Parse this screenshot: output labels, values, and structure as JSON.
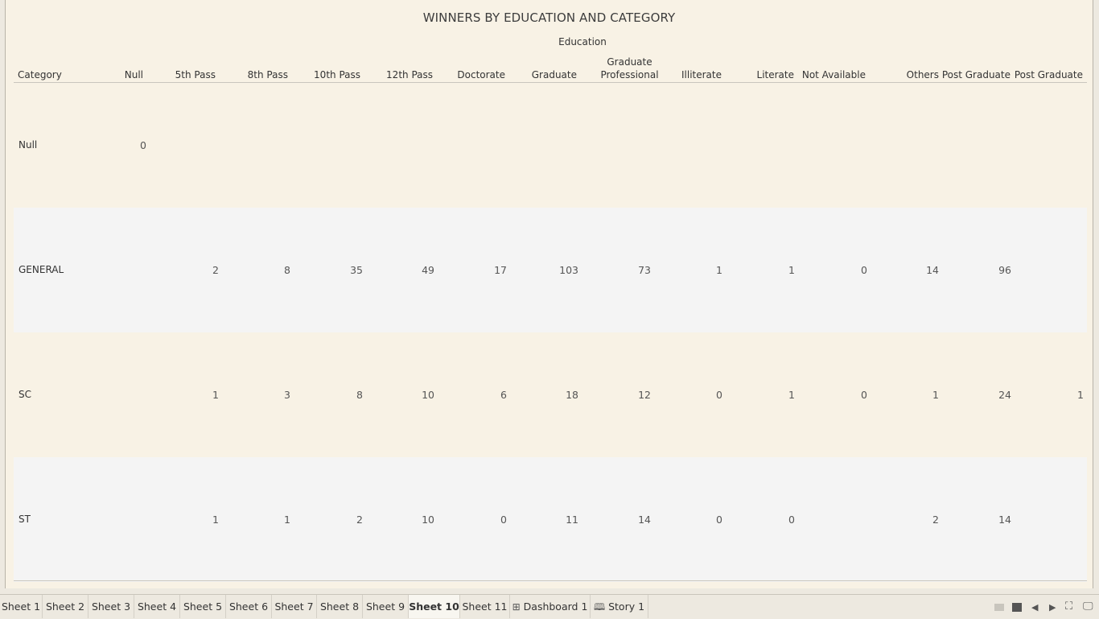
{
  "title": "WINNERS BY EDUCATION AND CATEGORY",
  "column_group_label": "Education",
  "row_header": "Category",
  "columns": [
    "Null",
    "5th Pass",
    "8th Pass",
    "10th Pass",
    "12th Pass",
    "Doctorate",
    "Graduate",
    "Graduate Professional",
    "Illiterate",
    "Literate",
    "Not Available",
    "Others",
    "Post Graduate",
    "Post Graduate"
  ],
  "column_gp_line1": "Graduate",
  "column_gp_line2": "Professional",
  "rows": [
    {
      "label": "Null",
      "values": [
        "0",
        "",
        "",
        "",
        "",
        "",
        "",
        "",
        "",
        "",
        "",
        "",
        "",
        ""
      ]
    },
    {
      "label": "GENERAL",
      "values": [
        "",
        "2",
        "8",
        "35",
        "49",
        "17",
        "103",
        "73",
        "1",
        "1",
        "0",
        "14",
        "96",
        ""
      ]
    },
    {
      "label": "SC",
      "values": [
        "",
        "1",
        "3",
        "8",
        "10",
        "6",
        "18",
        "12",
        "0",
        "1",
        "0",
        "1",
        "24",
        "1"
      ]
    },
    {
      "label": "ST",
      "values": [
        "",
        "1",
        "1",
        "2",
        "10",
        "0",
        "11",
        "14",
        "0",
        "0",
        "",
        "2",
        "14",
        ""
      ]
    }
  ],
  "tabs": [
    "Sheet 1",
    "Sheet 2",
    "Sheet 3",
    "Sheet 4",
    "Sheet 5",
    "Sheet 6",
    "Sheet 7",
    "Sheet 8",
    "Sheet 9",
    "Sheet 10",
    "Sheet 11",
    "Dashboard 1",
    "Story 1"
  ],
  "active_tab": "Sheet 10",
  "colors": {
    "canvas": "#f8f2e5",
    "alt_row": "#f4f4f4",
    "tab_bar": "#ede9e0"
  }
}
